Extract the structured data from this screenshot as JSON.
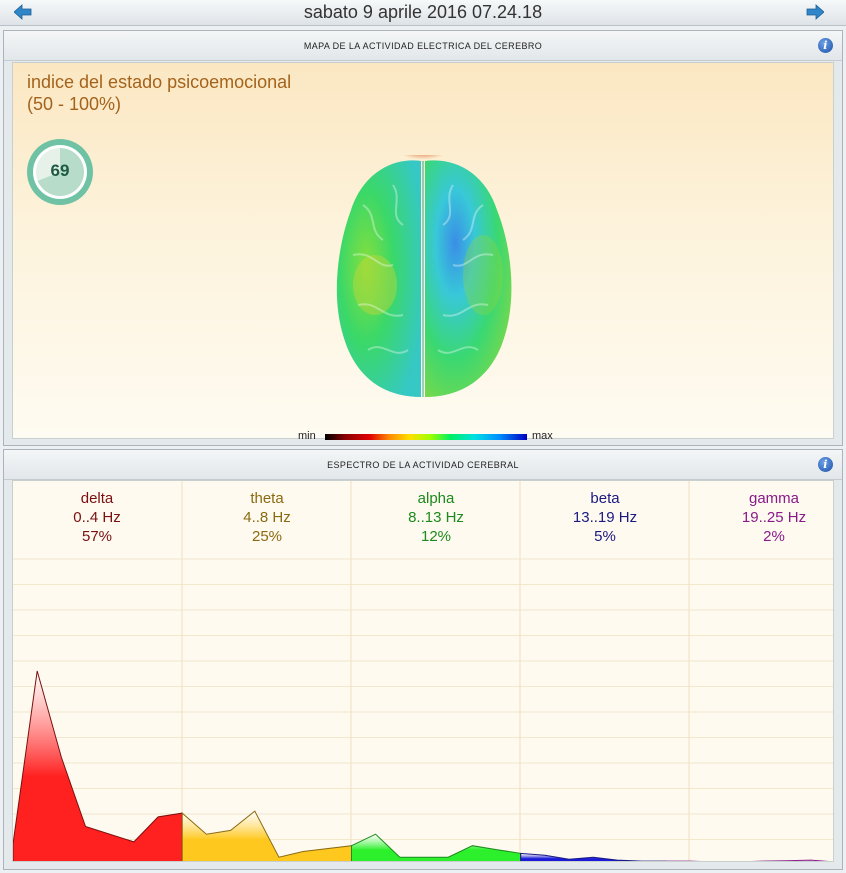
{
  "header": {
    "datetime": "sabato 9 aprile 2016 07.24.18"
  },
  "nav": {
    "prev_icon": "arrow-left-icon",
    "next_icon": "arrow-right-icon",
    "arrow_color": "#2f86c9"
  },
  "map_panel": {
    "title": "MAPA DE LA ACTIVIDAD ELECTRICA DEL CEREBRO",
    "info_icon": "info-icon",
    "index_title": "indice del estado psicoemocional",
    "index_range": "(50 - 100%)",
    "gauge_value": "69",
    "gauge_fraction": 0.69,
    "gauge_color": "#6fc2a4",
    "scale_min": "min",
    "scale_max": "max",
    "brain_image": "brain-activity-map"
  },
  "spectrum_panel": {
    "title": "ESPECTRO DE LA ACTIVIDAD CEREBRAL",
    "info_icon": "info-icon",
    "bands": [
      {
        "name": "delta",
        "range": "0..4 Hz",
        "percent": "57%",
        "color": "#7a1010",
        "fill": "#ff2020"
      },
      {
        "name": "theta",
        "range": "4..8 Hz",
        "percent": "25%",
        "color": "#8a6a10",
        "fill": "#ffc81e"
      },
      {
        "name": "alpha",
        "range": "8..13 Hz",
        "percent": "12%",
        "color": "#1c8a1c",
        "fill": "#2cf02c"
      },
      {
        "name": "beta",
        "range": "13..19 Hz",
        "percent": "5%",
        "color": "#1a1a80",
        "fill": "#1a1ad8"
      },
      {
        "name": "gamma",
        "range": "19..25 Hz",
        "percent": "2%",
        "color": "#8a1a8a",
        "fill": "#e050e0"
      }
    ]
  },
  "chart_data": {
    "type": "area",
    "xlim": [
      0,
      25
    ],
    "ylim": [
      0,
      1
    ],
    "series": [
      {
        "name": "delta",
        "x": [
          0,
          1,
          2,
          3,
          5,
          6,
          7
        ],
        "y": [
          0.1,
          1.0,
          0.55,
          0.19,
          0.11,
          0.24,
          0.26
        ]
      },
      {
        "name": "theta",
        "x": [
          7,
          8,
          9,
          10,
          11,
          12,
          14
        ],
        "y": [
          0.26,
          0.15,
          0.17,
          0.27,
          0.03,
          0.06,
          0.09
        ]
      },
      {
        "name": "alpha",
        "x": [
          14,
          15,
          16,
          17,
          18,
          19,
          20,
          21
        ],
        "y": [
          0.09,
          0.15,
          0.03,
          0.03,
          0.03,
          0.09,
          0.07,
          0.05
        ]
      },
      {
        "name": "beta",
        "x": [
          21,
          22,
          23,
          24,
          25,
          26,
          27
        ],
        "y": [
          0.05,
          0.04,
          0.02,
          0.03,
          0.015,
          0.01,
          0.01
        ]
      },
      {
        "name": "gamma",
        "x": [
          27,
          28,
          29,
          30,
          31,
          32,
          33,
          34
        ],
        "y": [
          0.01,
          0.01,
          0.005,
          0.005,
          0.01,
          0.012,
          0.015,
          0.005
        ]
      }
    ]
  }
}
